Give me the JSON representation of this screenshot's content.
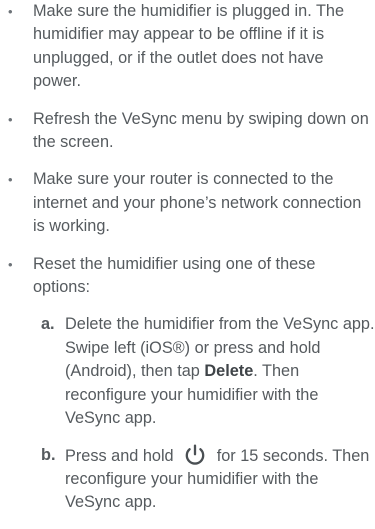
{
  "bullet_marker": "•",
  "bullets": [
    {
      "text": "Make sure the humidifier is plugged in. The humidifier may appear to be offline if it is unplugged, or if the outlet does not have power."
    },
    {
      "text": "Refresh the VeSync menu by swiping down on the screen."
    },
    {
      "text": "Make sure your router is connected to the internet and your phone’s network connection is working."
    },
    {
      "text": "Reset the humidifier using one of these options:"
    }
  ],
  "reset_options": [
    {
      "marker": "a.",
      "text_before": "Delete the humidifier from the VeSync app. Swipe left (iOS®) or press and hold (Android), then tap ",
      "emphasis": "Delete",
      "text_after": ". Then reconfigure your humidifier with the VeSync app."
    },
    {
      "marker": "b.",
      "text_before": "Press and hold",
      "icon": "power-icon",
      "text_after": "for 15 seconds. Then reconfigure your humidifier with the VeSync app."
    }
  ],
  "colors": {
    "text": "#555a5e",
    "emphasis": "#3f4448",
    "icon": "#4a4f53"
  }
}
